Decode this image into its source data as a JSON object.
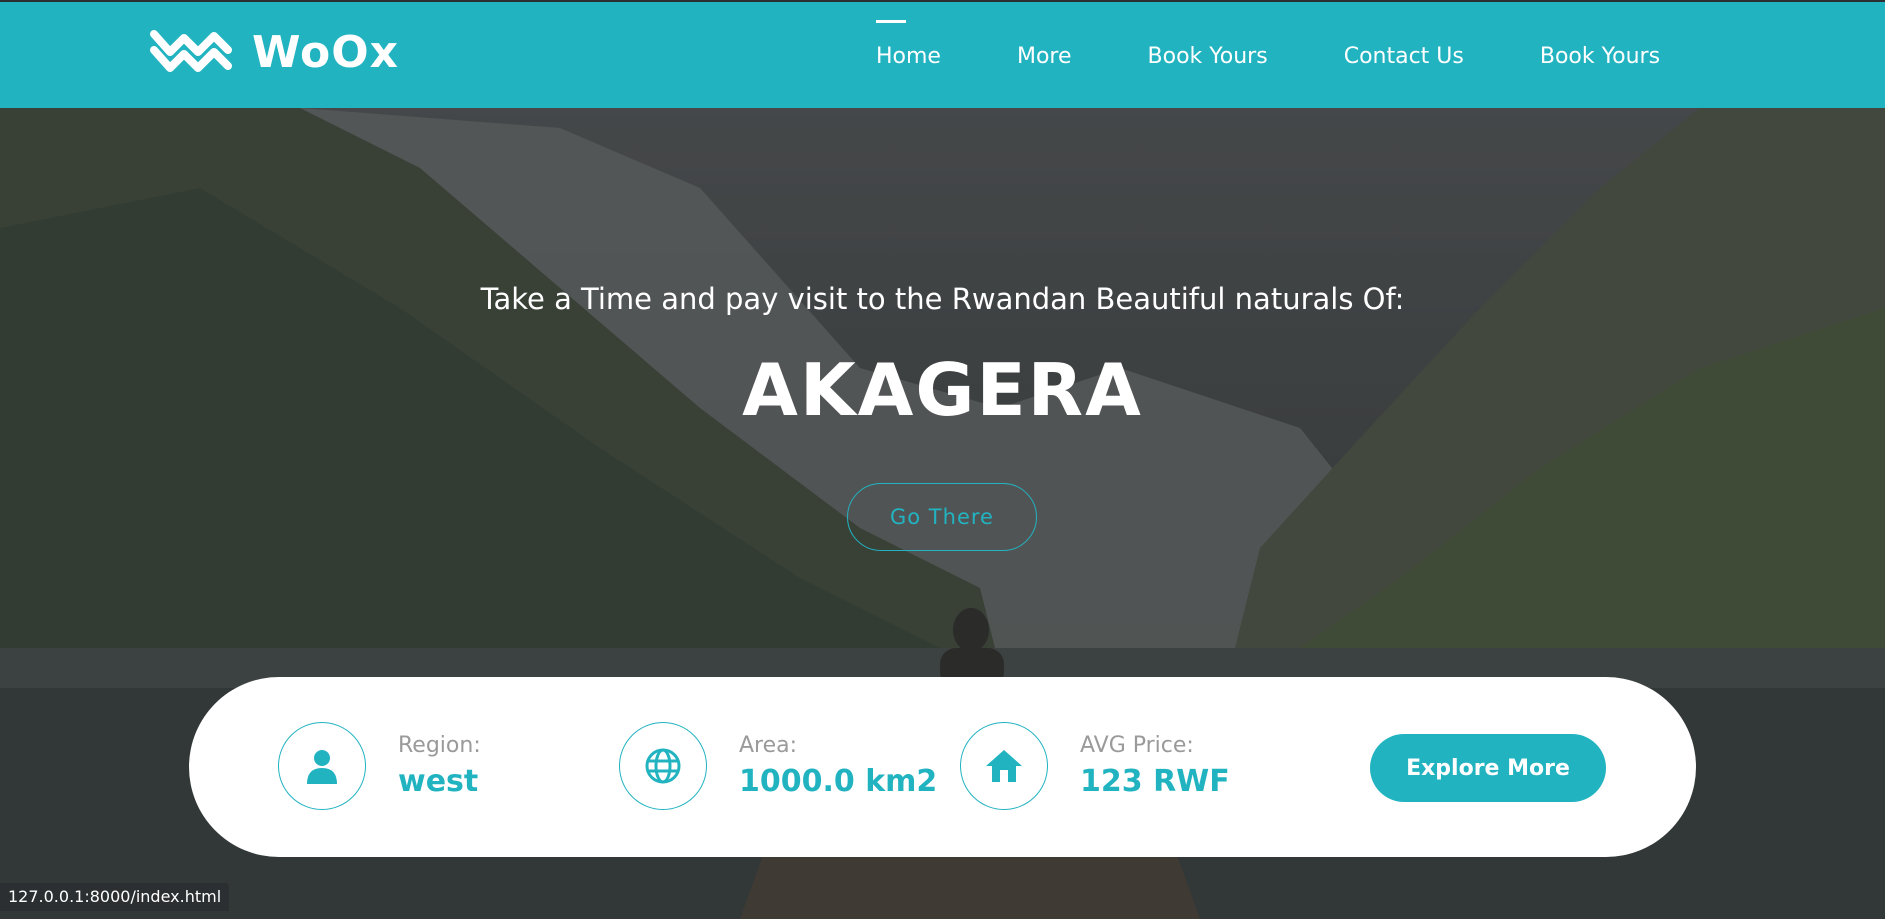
{
  "app": {
    "name": "WoOx"
  },
  "nav": {
    "items": [
      {
        "label": "Home",
        "active": true
      },
      {
        "label": "More"
      },
      {
        "label": "Book Yours"
      },
      {
        "label": "Contact Us"
      },
      {
        "label": "Book Yours"
      }
    ]
  },
  "hero": {
    "subtitle": "Take a Time and pay visit to the Rwandan Beautiful naturals Of:",
    "title": "AKAGERA",
    "go_button": "Go There"
  },
  "info": {
    "region": {
      "label": "Region:",
      "value": "west",
      "icon": "user-icon"
    },
    "area": {
      "label": "Area:",
      "value": "1000.0 km2",
      "icon": "globe-icon"
    },
    "price": {
      "label": "AVG Price:",
      "value": "123 RWF",
      "icon": "home-icon"
    },
    "explore_button": "Explore More"
  },
  "status": {
    "url": "127.0.0.1:8000/index.html"
  },
  "colors": {
    "accent": "#22b3c1",
    "white": "#ffffff",
    "muted": "#9a9a9a"
  }
}
